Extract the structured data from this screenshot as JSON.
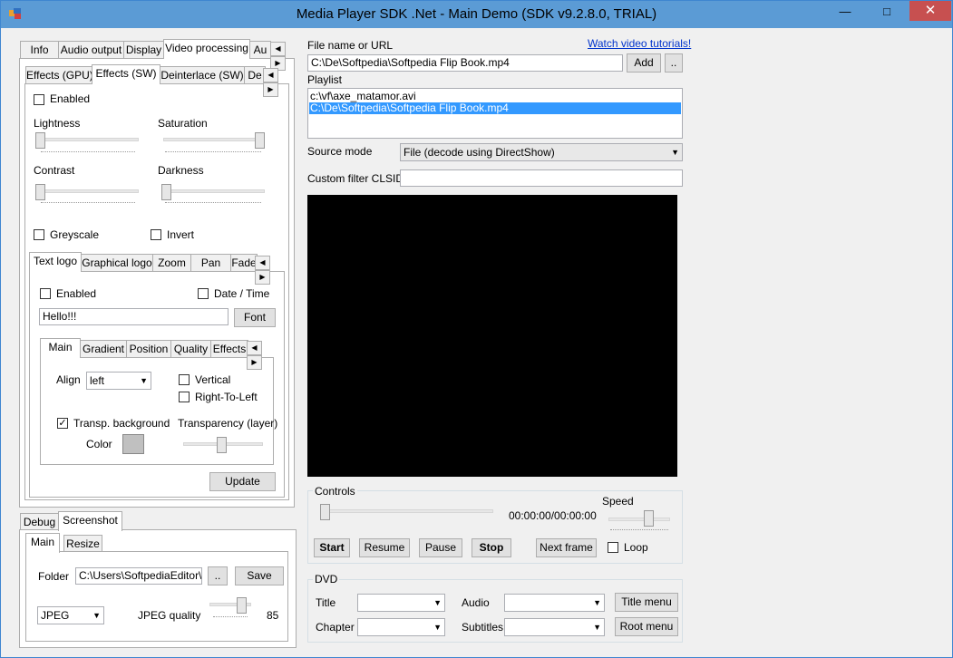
{
  "window": {
    "title": "Media Player SDK .Net - Main Demo (SDK v9.2.8.0, TRIAL)"
  },
  "main_tabs": [
    "Info",
    "Audio output",
    "Display",
    "Video processing",
    "Au"
  ],
  "sub_tabs": [
    "Effects (GPU)",
    "Effects (SW)",
    "Deinterlace (SW)",
    "De"
  ],
  "effects": {
    "enabled_label": "Enabled",
    "lightness_label": "Lightness",
    "saturation_label": "Saturation",
    "contrast_label": "Contrast",
    "darkness_label": "Darkness",
    "greyscale_label": "Greyscale",
    "invert_label": "Invert"
  },
  "logo_tabs": [
    "Text logo",
    "Graphical logo",
    "Zoom",
    "Pan",
    "Fade"
  ],
  "text_logo": {
    "enabled_label": "Enabled",
    "date_time_label": "Date / Time",
    "text_value": "Hello!!!",
    "font_button": "Font",
    "inner_tabs": [
      "Main",
      "Gradient",
      "Position",
      "Quality",
      "Effects"
    ],
    "align_label": "Align",
    "align_value": "left",
    "vertical_label": "Vertical",
    "rtl_label": "Right-To-Left",
    "transp_bg_label": "Transp. background",
    "transparency_label": "Transparency (layer)",
    "color_label": "Color",
    "update_button": "Update"
  },
  "bottom_tabs": [
    "Debug",
    "Screenshot"
  ],
  "screenshot_tabs": [
    "Main",
    "Resize"
  ],
  "screenshot": {
    "folder_label": "Folder",
    "folder_value": "C:\\Users\\SoftpediaEditor\\De",
    "browse_button": "..",
    "save_button": "Save",
    "format_value": "JPEG",
    "quality_label": "JPEG quality",
    "quality_value": "85"
  },
  "file": {
    "label": "File name or URL",
    "value": "C:\\De\\Softpedia\\Softpedia Flip Book.mp4",
    "add_button": "Add",
    "browse_button": "..",
    "tutorials_link": "Watch video tutorials!"
  },
  "playlist": {
    "label": "Playlist",
    "items": [
      "c:\\vf\\axe_matamor.avi",
      "C:\\De\\Softpedia\\Softpedia Flip Book.mp4"
    ]
  },
  "source_mode": {
    "label": "Source mode",
    "value": "File (decode using DirectShow)"
  },
  "custom_filter": {
    "label": "Custom filter CLSID",
    "value": ""
  },
  "controls": {
    "label": "Controls",
    "time": "00:00:00/00:00:00",
    "speed_label": "Speed",
    "start": "Start",
    "resume": "Resume",
    "pause": "Pause",
    "stop": "Stop",
    "next_frame": "Next frame",
    "loop_label": "Loop"
  },
  "dvd": {
    "label": "DVD",
    "title_label": "Title",
    "chapter_label": "Chapter",
    "audio_label": "Audio",
    "subtitles_label": "Subtitles",
    "title_menu": "Title menu",
    "root_menu": "Root menu"
  },
  "colors": {
    "titlebar": "#5b9bd5",
    "close": "#c75050",
    "selection": "#3399ff",
    "video": "#000000"
  }
}
